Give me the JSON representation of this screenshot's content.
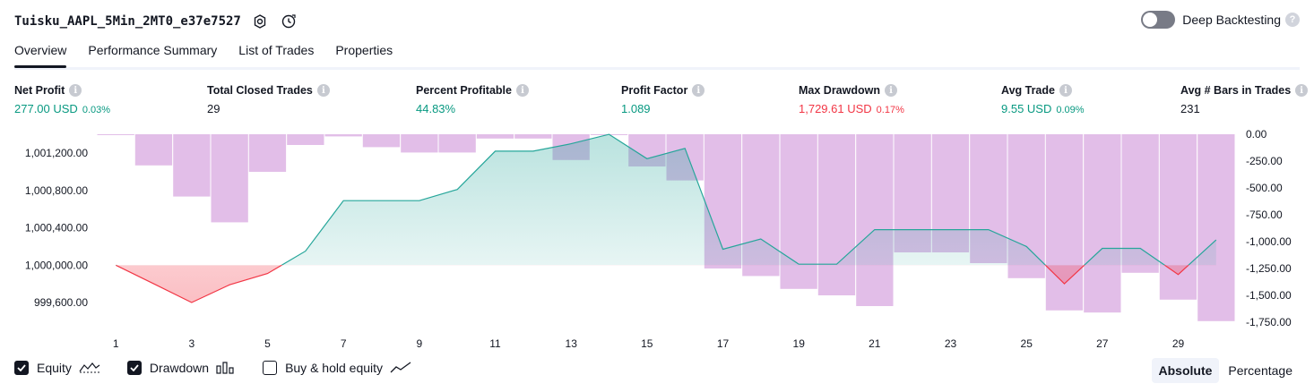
{
  "header": {
    "strategy_title": "Tuisku_AAPL_5Min_2MT0_e37e7527",
    "deep_backtesting_label": "Deep Backtesting",
    "help_glyph": "?"
  },
  "tabs": [
    {
      "label": "Overview",
      "active": true
    },
    {
      "label": "Performance Summary",
      "active": false
    },
    {
      "label": "List of Trades",
      "active": false
    },
    {
      "label": "Properties",
      "active": false
    }
  ],
  "stats": [
    {
      "label": "Net Profit",
      "value": "277.00 USD",
      "pct": "0.03%",
      "color": "green"
    },
    {
      "label": "Total Closed Trades",
      "value": "29",
      "pct": "",
      "color": "dark"
    },
    {
      "label": "Percent Profitable",
      "value": "44.83%",
      "pct": "",
      "color": "green"
    },
    {
      "label": "Profit Factor",
      "value": "1.089",
      "pct": "",
      "color": "green"
    },
    {
      "label": "Max Drawdown",
      "value": "1,729.61 USD",
      "pct": "0.17%",
      "color": "red"
    },
    {
      "label": "Avg Trade",
      "value": "9.55 USD",
      "pct": "0.09%",
      "color": "green"
    },
    {
      "label": "Avg # Bars in Trades",
      "value": "231",
      "pct": "",
      "color": "dark"
    }
  ],
  "info_glyph": "i",
  "legend": {
    "equity_label": "Equity",
    "drawdown_label": "Drawdown",
    "buy_hold_label": "Buy & hold equity"
  },
  "mode": {
    "absolute_label": "Absolute",
    "percentage_label": "Percentage"
  },
  "colors": {
    "equity_up": "#26a69a",
    "equity_down": "#f23645",
    "drawdown_bar": "#ce93d8",
    "accent_text": "#089981"
  },
  "chart_data": {
    "type": "line",
    "x_ticks": [
      "1",
      "3",
      "5",
      "7",
      "9",
      "11",
      "13",
      "15",
      "17",
      "19",
      "21",
      "23",
      "25",
      "27",
      "29"
    ],
    "left_axis": {
      "ticks": [
        "1,001,200.00",
        "1,000,800.00",
        "1,000,400.00",
        "1,000,000.00",
        "999,600.00"
      ],
      "range": [
        999400,
        1001350
      ]
    },
    "right_axis": {
      "ticks": [
        "0.00",
        "-250.00",
        "-500.00",
        "-750.00",
        "-1,000.00",
        "-1,250.00",
        "-1,500.00",
        "-1,750.00"
      ],
      "range": [
        -1770,
        0
      ]
    },
    "series": [
      {
        "kind": "equity",
        "x": [
          1,
          2,
          3,
          4,
          5,
          6,
          7,
          8,
          9,
          10,
          11,
          12,
          13,
          14,
          15,
          16,
          17,
          18,
          19,
          20,
          21,
          22,
          23,
          24,
          25,
          26,
          27,
          28,
          29,
          30
        ],
        "values": [
          1000000,
          999800,
          999600,
          999790,
          999910,
          1000150,
          1000690,
          1000690,
          1000690,
          1000810,
          1001220,
          1001220,
          1001300,
          1001400,
          1001140,
          1001250,
          1000170,
          1000280,
          1000010,
          1000010,
          1000380,
          1000380,
          1000380,
          1000380,
          1000200,
          999800,
          1000180,
          1000180,
          999900,
          1000270
        ]
      },
      {
        "kind": "drawdown",
        "x": [
          1,
          2,
          3,
          4,
          5,
          6,
          7,
          8,
          9,
          10,
          11,
          12,
          13,
          14,
          15,
          16,
          17,
          18,
          19,
          20,
          21,
          22,
          23,
          24,
          25,
          26,
          27,
          28,
          29,
          30
        ],
        "values": [
          0,
          -290,
          -580,
          -820,
          -350,
          -100,
          -20,
          -120,
          -170,
          -170,
          -40,
          -40,
          -240,
          0,
          -300,
          -430,
          -1250,
          -1320,
          -1440,
          -1500,
          -1600,
          -1100,
          -1100,
          -1200,
          -1340,
          -1640,
          -1660,
          -1290,
          -1540,
          -1740
        ]
      }
    ],
    "grid": false,
    "legend_placement": "bottom-left"
  }
}
